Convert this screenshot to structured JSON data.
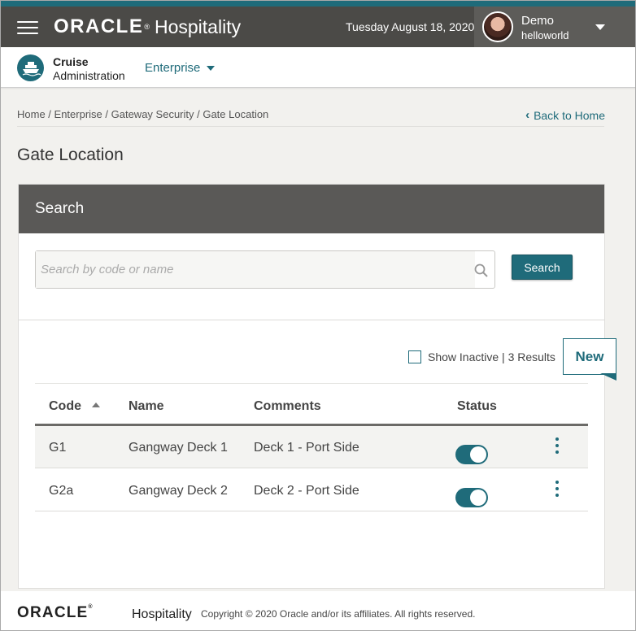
{
  "header": {
    "brand_oracle": "ORACLE",
    "brand_reg": "®",
    "brand_product": "Hospitality",
    "date": "Tuesday August 18, 2020",
    "user": {
      "name": "Demo",
      "sub": "helloworld"
    }
  },
  "subheader": {
    "module_line1": "Cruise",
    "module_line2": "Administration",
    "enterprise_label": "Enterprise"
  },
  "breadcrumb": {
    "items": [
      "Home",
      "Enterprise",
      "Gateway Security",
      "Gate Location"
    ],
    "separator": " / ",
    "back_label": "Back to Home"
  },
  "page_title": "Gate Location",
  "search_panel": {
    "title": "Search",
    "placeholder": "Search by code or name",
    "value": "",
    "button_label": "Search"
  },
  "results": {
    "show_inactive_label": "Show Inactive | 3 Results",
    "show_inactive_checked": false,
    "new_label": "New",
    "columns": [
      "Code",
      "Name",
      "Comments",
      "Status"
    ],
    "sort_column": "Code",
    "sort_direction": "ascending",
    "rows": [
      {
        "code": "G1",
        "name": "Gangway Deck 1",
        "comments": "Deck 1 - Port Side",
        "status_active": true
      },
      {
        "code": "G2a",
        "name": "Gangway Deck 2",
        "comments": "Deck 2 - Port Side",
        "status_active": true
      }
    ]
  },
  "footer": {
    "oracle": "ORACLE",
    "reg": "®",
    "product": "Hospitality",
    "copyright": "Copyright © 2020 Oracle and/or its affiliates. All rights reserved."
  },
  "colors": {
    "accent": "#1f6b7a",
    "topbar": "#4b4a47",
    "panel_header": "#5a5957"
  },
  "icons": [
    "hamburger-menu-icon",
    "ship-icon",
    "chevron-down-icon",
    "chevron-left-icon",
    "search-icon",
    "sort-ascending-icon",
    "toggle-switch",
    "kebab-menu-icon"
  ]
}
